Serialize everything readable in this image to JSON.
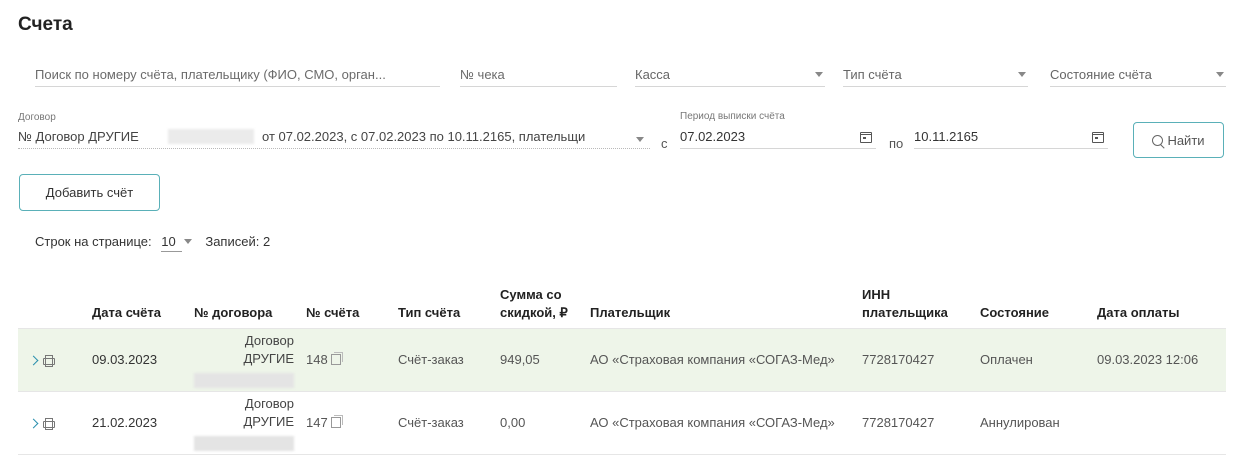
{
  "page": {
    "title": "Счета"
  },
  "filters": {
    "search_placeholder": "Поиск по номеру счёта, плательщику (ФИО, СМО, орган...",
    "check_placeholder": "№ чека",
    "cashbox_placeholder": "Касса",
    "invoice_type_placeholder": "Тип счёта",
    "invoice_state_placeholder": "Состояние счёта",
    "contract_label": "Договор",
    "contract_value_prefix": "№ Договор  ДРУГИЕ",
    "contract_value_suffix": "от 07.02.2023, с 07.02.2023 по 10.11.2165, плательщи",
    "period_label": "Период выписки счёта",
    "from_label": "с",
    "date_from": "07.02.2023",
    "to_label": "по",
    "date_to": "10.11.2165",
    "find_label": "Найти"
  },
  "actions": {
    "add_invoice_label": "Добавить счёт"
  },
  "pagination": {
    "rows_per_page_label": "Строк на странице:",
    "rows_per_page_value": "10",
    "records_label": "Записей:",
    "records_count": "2"
  },
  "table": {
    "headers": [
      "Дата счёта",
      "№ договора",
      "№ счёта",
      "Тип счёта",
      "Сумма со скидкой, ₽",
      "Плательщик",
      "ИНН плательщика",
      "Состояние",
      "Дата оплаты"
    ],
    "rows": [
      {
        "date": "09.03.2023",
        "contract_line1": "Договор",
        "contract_line2": "ДРУГИЕ",
        "number": "148",
        "type": "Счёт-заказ",
        "amount": "949,05",
        "payer": "АО «Страховая компания «СОГАЗ-Мед»",
        "inn": "7728170427",
        "state": "Оплачен",
        "paid_date": "09.03.2023 12:06"
      },
      {
        "date": "21.02.2023",
        "contract_line1": "Договор",
        "contract_line2": "ДРУГИЕ",
        "number": "147",
        "type": "Счёт-заказ",
        "amount": "0,00",
        "payer": "АО «Страховая компания «СОГАЗ-Мед»",
        "inn": "7728170427",
        "state": "Аннулирован",
        "paid_date": ""
      }
    ]
  }
}
